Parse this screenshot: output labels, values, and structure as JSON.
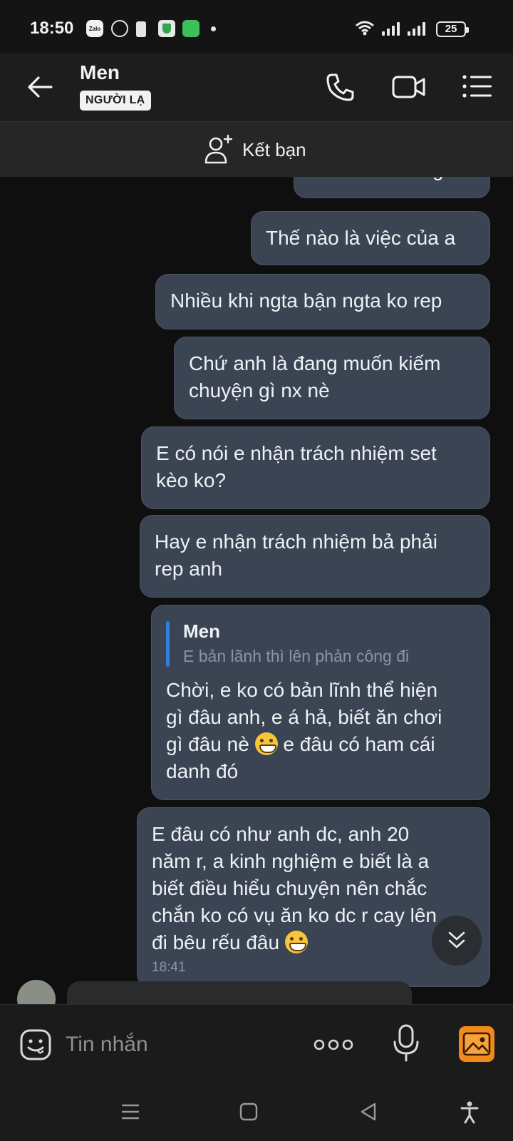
{
  "status_bar": {
    "time": "18:50",
    "battery": "25",
    "notification_icons": [
      "zalo-icon",
      "messenger-icon",
      "battery-saver-icon",
      "shield-icon",
      "app-icon"
    ]
  },
  "header": {
    "name": "Men",
    "badge": "NGƯỜI LẠ"
  },
  "friend_bar": {
    "label": "Kết bạn"
  },
  "messages": [
    {
      "lines": [
        "Anh nên với ngta"
      ]
    },
    {
      "lines": [
        "Thế nào là việc của a"
      ]
    },
    {
      "lines": [
        "Nhiều khi ngta bận ngta ko rep"
      ]
    },
    {
      "lines": [
        "Chứ anh là đang muốn kiếm",
        "chuyện gì nx nè"
      ]
    },
    {
      "lines": [
        "E có nói e nhận trách nhiệm set",
        "kèo ko?"
      ]
    },
    {
      "lines": [
        "Hay e nhận trách nhiệm bả phải",
        "rep anh"
      ]
    },
    {
      "quote": {
        "author": "Men",
        "text": "E bản lãnh thì lên phản công đi"
      },
      "lines": [
        "Chời, e ko có bản lĩnh thể hiện",
        "gì đâu anh, e á hả, biết ăn chơi",
        "gì đâu nè",
        "e đâu có ham cái",
        "danh đó"
      ]
    },
    {
      "lines": [
        "E đâu có như anh dc, anh 20",
        "năm r, a kinh nghiệm e biết là a",
        "biết điều hiểu chuyện nên chắc",
        "chắn ko có vụ ăn ko dc r cay lên",
        "đi bêu rếu đâu"
      ],
      "time": "18:41"
    }
  ],
  "input": {
    "placeholder": "Tin nhắn"
  },
  "colors": {
    "outgoing_bubble": "#3a4452",
    "quote_bar": "#2f7ee0",
    "gallery_accent": "#f08a1c"
  }
}
